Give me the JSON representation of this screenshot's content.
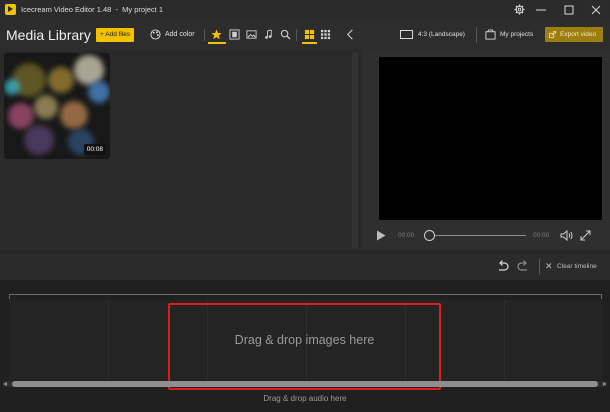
{
  "window": {
    "title": "Icecream Video Editor 1.48  -  My project 1",
    "controls": [
      "gear-icon",
      "minimize-icon",
      "maximize-icon",
      "close-icon"
    ]
  },
  "media_library": {
    "title": "Media Library",
    "add_files_label": "+ Add files",
    "add_color_label": "Add color",
    "filters": [
      "star-icon",
      "film-icon",
      "image-icon",
      "music-icon",
      "search-icon"
    ],
    "views": [
      "grid-large-icon",
      "grid-small-icon"
    ],
    "collapse_icon": "chevron-left-icon",
    "items": [
      {
        "duration": "00:08",
        "type": "video"
      }
    ]
  },
  "preview": {
    "aspect_ratio_label": "4:3 (Landscape)",
    "my_projects_label": "My projects",
    "export_label": "Export video",
    "current_time": "00:00",
    "total_time": "00:00",
    "progress": 0
  },
  "timeline": {
    "clear_label": "Clear timeline",
    "drop_images_label": "Drag & drop images here",
    "drop_audio_label": "Drag & drop audio here"
  },
  "colors": {
    "accent": "#f2c200",
    "export_bg": "#9c7f10",
    "highlight_border": "#e01d1d",
    "panel_bg": "#2a2a2a"
  }
}
